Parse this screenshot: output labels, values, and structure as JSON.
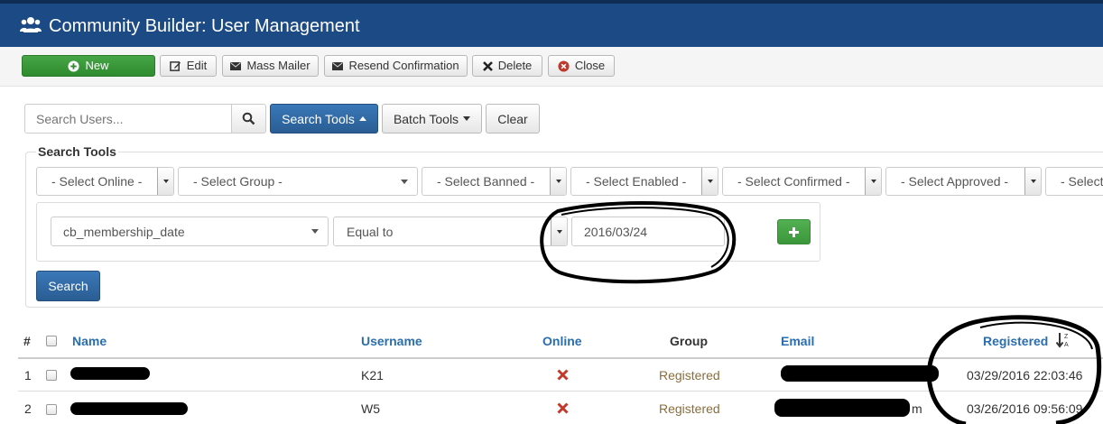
{
  "header": {
    "title": "Community Builder: User Management",
    "icon": "users-icon",
    "bg": "#1c4a84"
  },
  "toolbar": {
    "new": "New",
    "edit": "Edit",
    "mass_mailer": "Mass Mailer",
    "resend": "Resend Confirmation",
    "delete": "Delete",
    "close": "Close"
  },
  "search": {
    "placeholder": "Search Users...",
    "search_tools": "Search Tools",
    "batch_tools": "Batch Tools",
    "clear": "Clear"
  },
  "tools": {
    "legend": "Search Tools",
    "filters": {
      "online": "- Select Online -",
      "group": "- Select Group -",
      "banned": "- Select Banned -",
      "enabled": "- Select Enabled -",
      "confirmed": "- Select Confirmed -",
      "approved": "- Select Approved -",
      "more": "- Select"
    },
    "field": "cb_membership_date",
    "operator": "Equal to",
    "value": "2016/03/24",
    "search_button": "Search"
  },
  "table": {
    "headers": {
      "num": "#",
      "name": "Name",
      "username": "Username",
      "online": "Online",
      "group": "Group",
      "email": "Email",
      "registered": "Registered"
    },
    "rows": [
      {
        "num": "1",
        "username": "K21",
        "group": "Registered",
        "registered": "03/29/2016 22:03:46"
      },
      {
        "num": "2",
        "username": "W5",
        "group": "Registered",
        "email_tail": "m",
        "registered": "03/26/2016 09:56:09"
      }
    ]
  },
  "colors": {
    "link": "#2a6ead",
    "primary": "#2a5d93",
    "success": "#3a963a",
    "offline_x": "#c0392b",
    "group_text": "#8a6d3b"
  }
}
